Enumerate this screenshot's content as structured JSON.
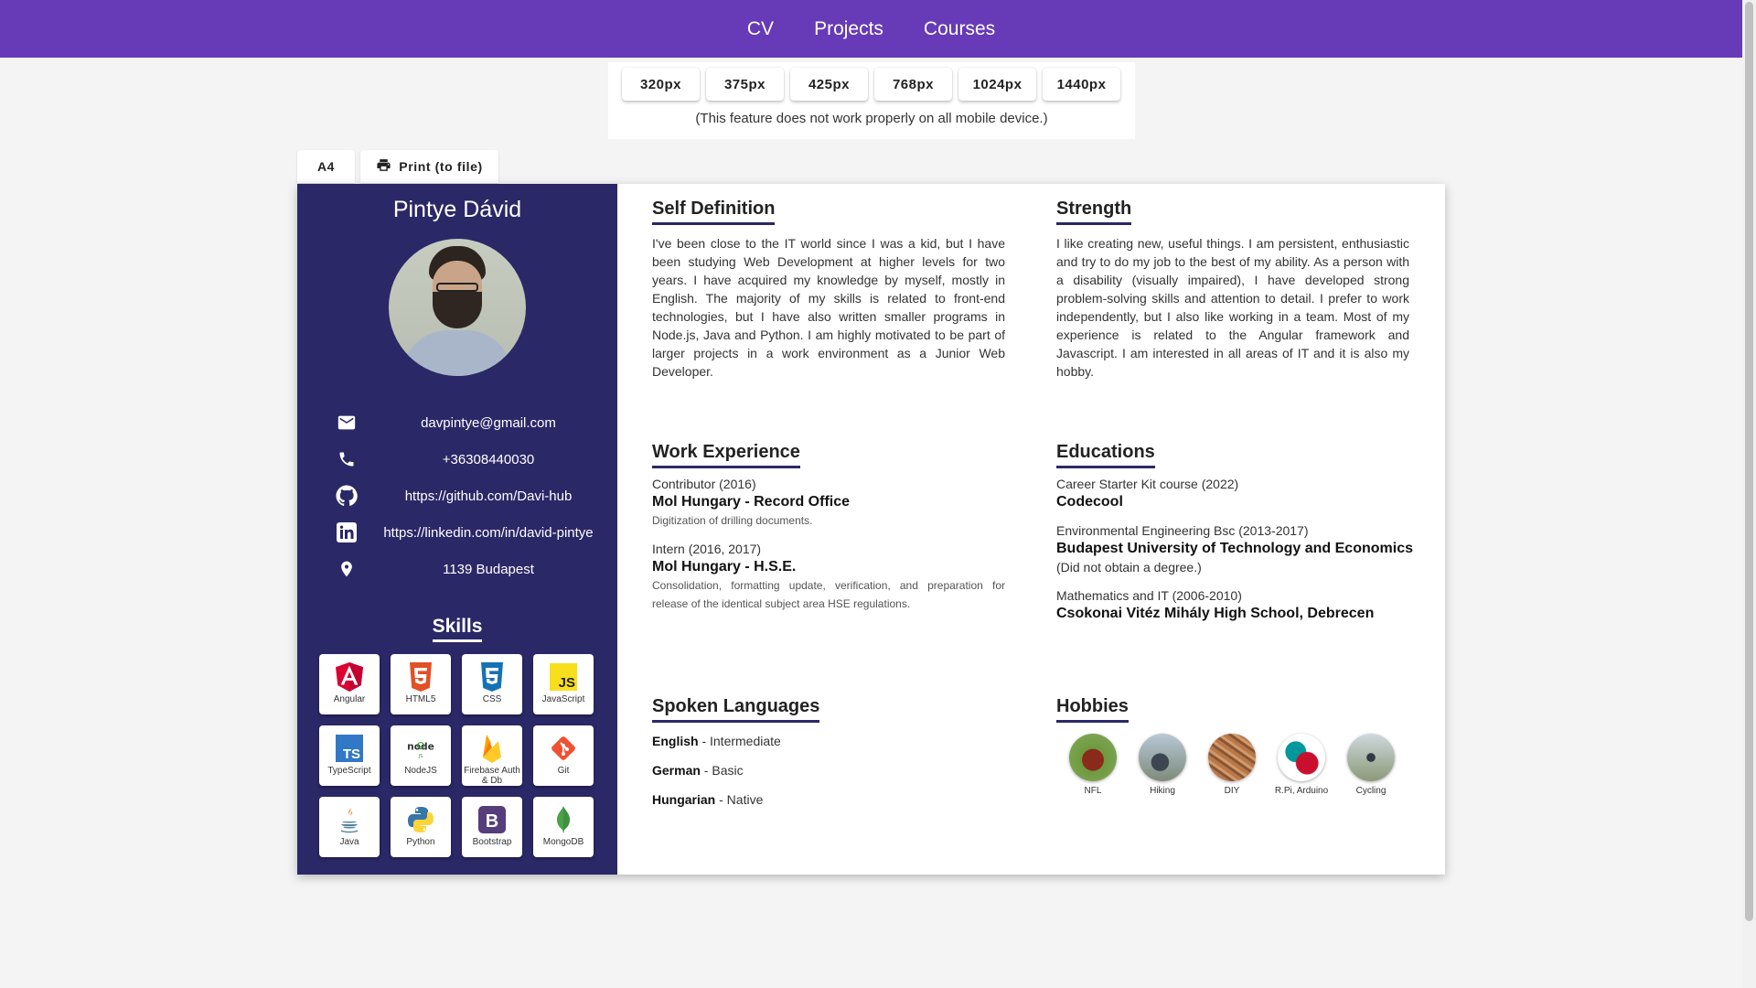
{
  "nav": {
    "items": [
      "CV",
      "Projects",
      "Courses"
    ]
  },
  "responsive": {
    "buttons": [
      "320px",
      "375px",
      "425px",
      "768px",
      "1024px",
      "1440px"
    ],
    "note": "(This feature does not work properly on all mobile device.)"
  },
  "toolbar": {
    "a4_label": "A4",
    "print_label": "Print (to file)"
  },
  "profile": {
    "name": "Pintye Dávid",
    "contacts": [
      {
        "icon": "mail-icon",
        "text": "davpintye@gmail.com"
      },
      {
        "icon": "phone-icon",
        "text": "+36308440030"
      },
      {
        "icon": "github-icon",
        "text": "https://github.com/Davi-hub"
      },
      {
        "icon": "linkedin-icon",
        "text": "https://linkedin.com/in/david-pintye"
      },
      {
        "icon": "location-icon",
        "text": "1139 Budapest"
      }
    ]
  },
  "skills": {
    "title": "Skills",
    "items": [
      {
        "label": "Angular",
        "icon": "angular-icon",
        "color": "#dd0031"
      },
      {
        "label": "HTML5",
        "icon": "html5-icon",
        "color": "#e34f26"
      },
      {
        "label": "CSS",
        "icon": "css3-icon",
        "color": "#1572b6"
      },
      {
        "label": "JavaScript",
        "icon": "javascript-icon",
        "color": "#f7df1e"
      },
      {
        "label": "TypeScript",
        "icon": "typescript-icon",
        "color": "#3178c6"
      },
      {
        "label": "NodeJS",
        "icon": "nodejs-icon",
        "color": "#339933"
      },
      {
        "label": "Firebase Auth & Db",
        "icon": "firebase-icon",
        "color": "#ffca28"
      },
      {
        "label": "Git",
        "icon": "git-icon",
        "color": "#f05032"
      },
      {
        "label": "Java",
        "icon": "java-icon",
        "color": "#e76f00"
      },
      {
        "label": "Python",
        "icon": "python-icon",
        "color": "#3776ab"
      },
      {
        "label": "Bootstrap",
        "icon": "bootstrap-icon",
        "color": "#563d7c"
      },
      {
        "label": "MongoDB",
        "icon": "mongodb-icon",
        "color": "#47a248"
      }
    ]
  },
  "self_definition": {
    "title": "Self Definition",
    "text": "I've been close to the IT world since I was a kid, but I have been studying Web Development at higher levels for two years. I have acquired my knowledge by myself, mostly in English. The majority of my skills is related to front-end technologies, but I have also written smaller programs in Node.js, Java and Python. I am highly motivated to be part of larger projects in a work environment as a Junior Web Developer."
  },
  "strength": {
    "title": "Strength",
    "text": "I like creating new, useful things. I am persistent, enthusiastic and try to do my job to the best of my ability. As a person with a disability (visually impaired), I have developed strong problem-solving skills and attention to detail. I prefer to work independently, but I also like working in a team. Most of my experience is related to the Angular framework and Javascript. I am interested in all areas of IT and it is also my hobby."
  },
  "work": {
    "title": "Work Experience",
    "entries": [
      {
        "role": "Contributor (2016)",
        "org": "Mol Hungary - Record Office",
        "desc": "Digitization of drilling documents."
      },
      {
        "role": "Intern (2016, 2017)",
        "org": "Mol Hungary - H.S.E.",
        "desc": "Consolidation, formatting update, verification, and preparation for release of the identical subject area HSE regulations."
      }
    ]
  },
  "education": {
    "title": "Educations",
    "entries": [
      {
        "role": "Career Starter Kit course (2022)",
        "org": "Codecool",
        "note": ""
      },
      {
        "role": "Environmental Engineering Bsc (2013-2017)",
        "org": "Budapest University of Technology and Economics",
        "note": "(Did not obtain a degree.)"
      },
      {
        "role": "Mathematics and IT (2006-2010)",
        "org": "Csokonai Vitéz Mihály High School, Debrecen",
        "note": ""
      }
    ]
  },
  "languages": {
    "title": "Spoken Languages",
    "items": [
      {
        "name": "English",
        "level": " - Intermediate"
      },
      {
        "name": "German",
        "level": " - Basic"
      },
      {
        "name": "Hungarian",
        "level": " - Native"
      }
    ]
  },
  "hobbies": {
    "title": "Hobbies",
    "items": [
      {
        "label": "NFL",
        "color": "#7a9a4a"
      },
      {
        "label": "Hiking",
        "color": "#8a9aa8"
      },
      {
        "label": "DIY",
        "color": "#b07a4e"
      },
      {
        "label": "R.Pi, Arduino",
        "color": "#c8102e"
      },
      {
        "label": "Cycling",
        "color": "#9aa4ae"
      }
    ]
  },
  "colors": {
    "nav": "#673ab7",
    "sidebar": "#2a2866"
  }
}
